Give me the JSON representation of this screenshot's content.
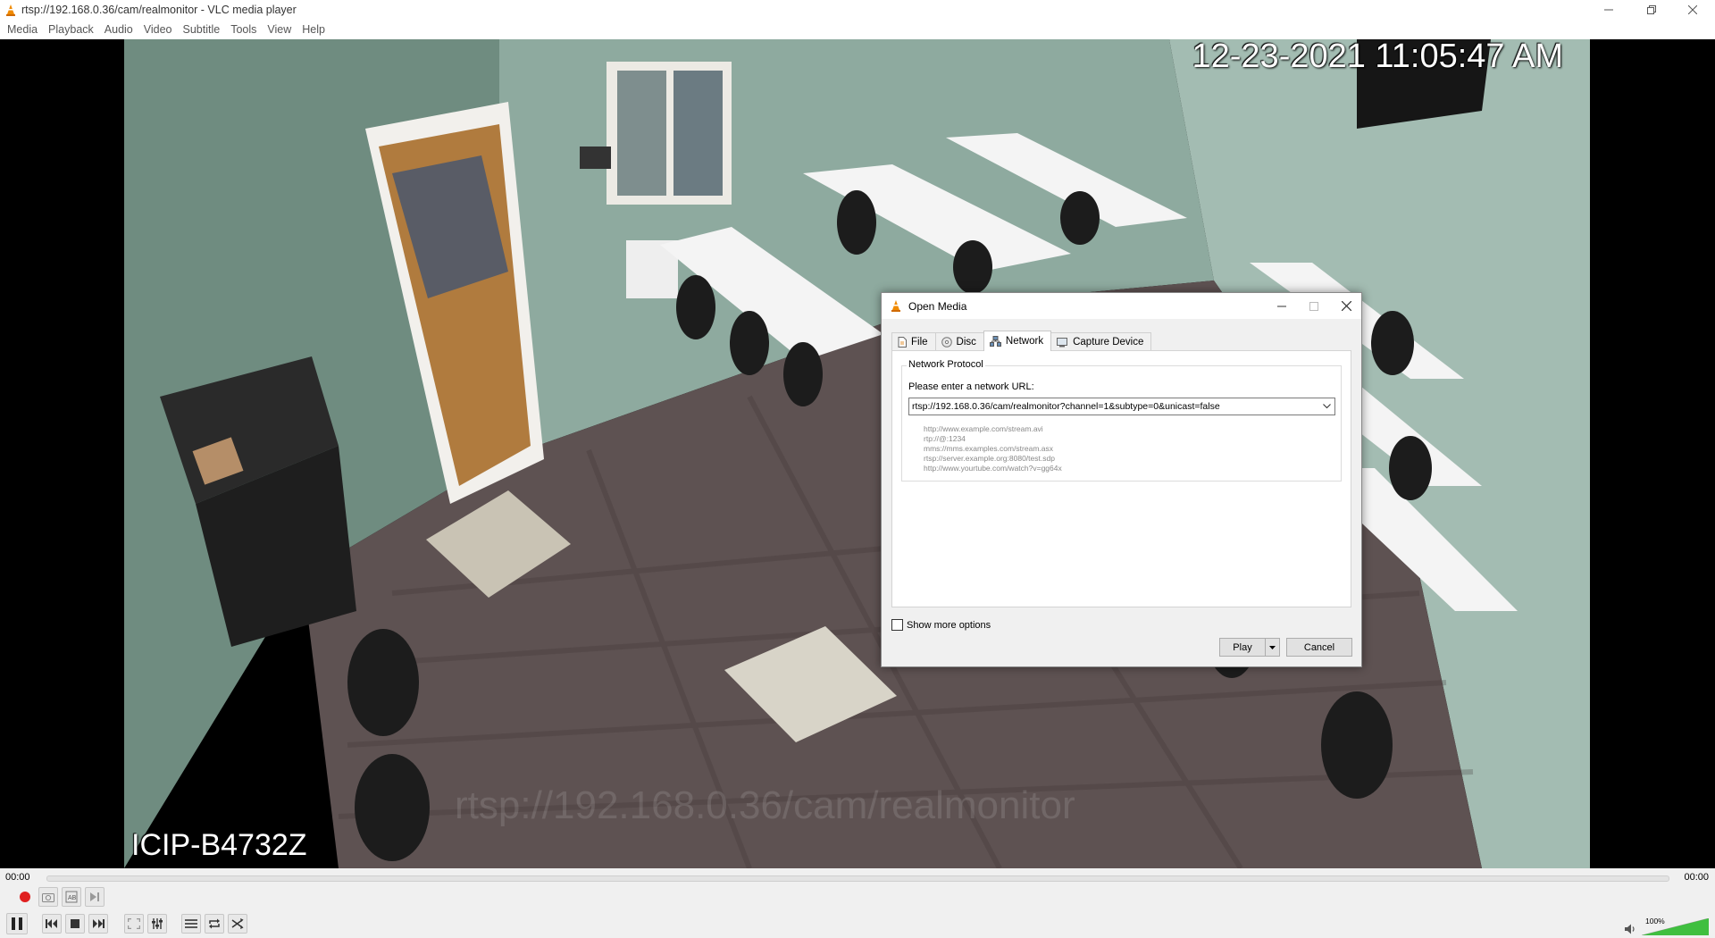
{
  "window": {
    "title": "rtsp://192.168.0.36/cam/realmonitor - VLC media player",
    "minimize": "minimize",
    "restore": "restore",
    "close": "close"
  },
  "menubar": [
    "Media",
    "Playback",
    "Audio",
    "Video",
    "Subtitle",
    "Tools",
    "View",
    "Help"
  ],
  "video": {
    "osd_timestamp": "12-23-2021 11:05:47 AM",
    "osd_camera_name": "ICIP-B4732Z",
    "osd_watermark": "rtsp://192.168.0.36/cam/realmonitor"
  },
  "dialog": {
    "title": "Open Media",
    "tabs": [
      {
        "label": "File",
        "icon": "file-icon",
        "active": false
      },
      {
        "label": "Disc",
        "icon": "disc-icon",
        "active": false
      },
      {
        "label": "Network",
        "icon": "network-icon",
        "active": true
      },
      {
        "label": "Capture Device",
        "icon": "capture-device-icon",
        "active": false
      }
    ],
    "group_title": "Network Protocol",
    "url_label": "Please enter a network URL:",
    "url_value": "rtsp://192.168.0.36/cam/realmonitor?channel=1&subtype=0&unicast=false",
    "examples": [
      "http://www.example.com/stream.avi",
      "rtp://@:1234",
      "mms://mms.examples.com/stream.asx",
      "rtsp://server.example.org:8080/test.sdp",
      "http://www.yourtube.com/watch?v=gg64x"
    ],
    "show_more_options": "Show more options",
    "show_more_checked": false,
    "play_label": "Play",
    "cancel_label": "Cancel"
  },
  "controls": {
    "time_elapsed": "00:00",
    "time_total": "00:00",
    "progress": 0,
    "volume_label": "100%",
    "volume_level": 1.0
  },
  "colors": {
    "record_red": "#e02020",
    "volume_green": "#3fbf3f",
    "osd_text": "#ffffff"
  }
}
